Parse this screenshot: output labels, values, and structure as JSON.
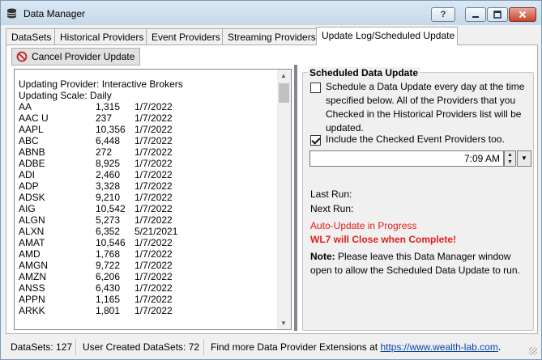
{
  "window": {
    "title": "Data Manager",
    "help_label": "?"
  },
  "tabs": [
    {
      "label": "DataSets"
    },
    {
      "label": "Historical Providers"
    },
    {
      "label": "Event Providers"
    },
    {
      "label": "Streaming Providers"
    },
    {
      "label": "Update Log/Scheduled Update"
    }
  ],
  "toolbar": {
    "cancel_label": "Cancel Provider Update"
  },
  "log": {
    "line1": "Updating Provider: Interactive Brokers",
    "line2": "Updating Scale: Daily",
    "rows": [
      {
        "symbol": "AA",
        "count": "1,315",
        "date": "1/7/2022"
      },
      {
        "symbol": "AAC U",
        "count": "237",
        "date": "1/7/2022"
      },
      {
        "symbol": "AAPL",
        "count": "10,356",
        "date": "1/7/2022"
      },
      {
        "symbol": "ABC",
        "count": "6,448",
        "date": "1/7/2022"
      },
      {
        "symbol": "ABNB",
        "count": "272",
        "date": "1/7/2022"
      },
      {
        "symbol": "ADBE",
        "count": "8,925",
        "date": "1/7/2022"
      },
      {
        "symbol": "ADI",
        "count": "2,460",
        "date": "1/7/2022"
      },
      {
        "symbol": "ADP",
        "count": "3,328",
        "date": "1/7/2022"
      },
      {
        "symbol": "ADSK",
        "count": "9,210",
        "date": "1/7/2022"
      },
      {
        "symbol": "AIG",
        "count": "10,542",
        "date": "1/7/2022"
      },
      {
        "symbol": "ALGN",
        "count": "5,273",
        "date": "1/7/2022"
      },
      {
        "symbol": "ALXN",
        "count": "6,352",
        "date": "5/21/2021"
      },
      {
        "symbol": "AMAT",
        "count": "10,546",
        "date": "1/7/2022"
      },
      {
        "symbol": "AMD",
        "count": "1,768",
        "date": "1/7/2022"
      },
      {
        "symbol": "AMGN",
        "count": "9,722",
        "date": "1/7/2022"
      },
      {
        "symbol": "AMZN",
        "count": "6,206",
        "date": "1/7/2022"
      },
      {
        "symbol": "ANSS",
        "count": "6,430",
        "date": "1/7/2022"
      },
      {
        "symbol": "APPN",
        "count": "1,165",
        "date": "1/7/2022"
      },
      {
        "symbol": "ARKK",
        "count": "1,801",
        "date": "1/7/2022"
      }
    ]
  },
  "scheduled": {
    "title": "Scheduled Data Update",
    "schedule_checkbox": {
      "checked": false,
      "line1": "Schedule a Data Update every day at the time",
      "line2": "specified below. All of the Providers that you",
      "line3": "Checked in the Historical Providers list will be",
      "line4": "updated."
    },
    "events_checkbox": {
      "checked": true,
      "label": "Include the Checked Event Providers too."
    },
    "time_value": "7:09 AM",
    "last_run_label": "Last Run:",
    "next_run_label": "Next Run:",
    "auto_update_text": "Auto-Update in Progress",
    "close_warning": "WL7 will Close when Complete!",
    "note_label": "Note:",
    "note_text": " Please leave this Data Manager window open to allow the Scheduled Data Update to run."
  },
  "statusbar": {
    "datasets": "DataSets: 127",
    "user_datasets": "User Created DataSets: 72",
    "find_more": "Find more Data Provider Extensions at ",
    "link": "https://www.wealth-lab.com",
    "period": "."
  },
  "colors": {
    "warning": "#e0201b",
    "link": "#0645ad"
  }
}
